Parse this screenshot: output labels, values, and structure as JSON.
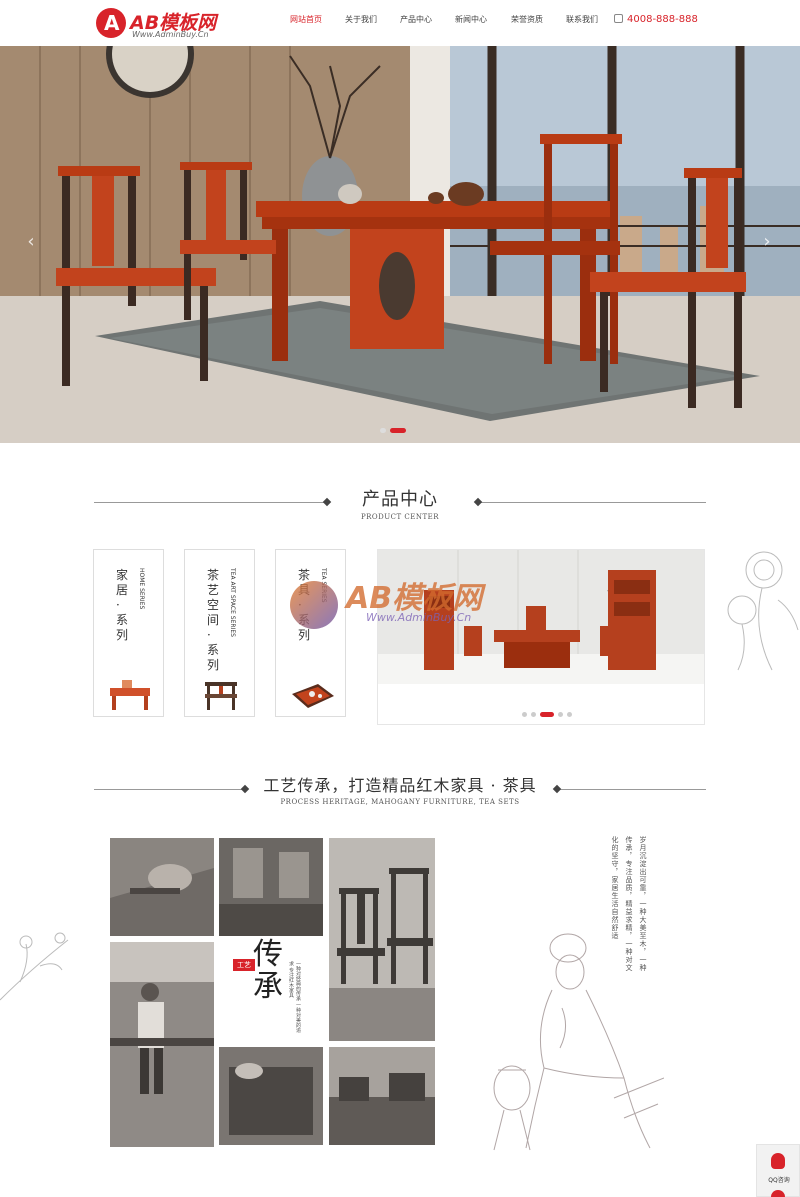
{
  "header": {
    "logo_text": "AB模板网",
    "logo_url": "Www.AdminBuy.Cn",
    "nav": [
      "网站首页",
      "关于我们",
      "产品中心",
      "新闻中心",
      "荣誉资质",
      "联系我们"
    ],
    "active_nav": "网站首页",
    "phone": "4008-888-888"
  },
  "hero": {
    "prev_icon": "chevron-left-icon",
    "next_icon": "chevron-right-icon",
    "slide_count": 2,
    "active_slide": 2
  },
  "products": {
    "title": "产品中心",
    "subtitle": "PRODUCT CENTER",
    "series": [
      {
        "cn": "家居·系列",
        "en": "HOME SERIES"
      },
      {
        "cn": "茶艺空间·系列",
        "en": "TEA ART SPACE SERIES"
      },
      {
        "cn": "茶具·系列",
        "en": "TEA SERIES"
      }
    ],
    "slider_count": 5,
    "slider_active": 3,
    "watermark_text": "AB模板网",
    "watermark_url": "Www.AdminBuy.Cn"
  },
  "craft": {
    "title": "工艺传承，打造精品红木家具 · 茶具",
    "subtitle": "PROCESS HERITAGE, MAHOGANY FURNITURE, TEA SETS",
    "stamp": "工艺",
    "big_text": "传承",
    "small_text": "一种对经典的传承 一种对美的追求 专注红木家具",
    "poem": "岁月沉淀出可靠，一种大美至木，一种传承，专注品质，精益求精，一种对文化的坚守，家居生活自然舒适"
  },
  "float": {
    "qq_label": "QQ咨询"
  },
  "colors": {
    "brand": "#d8232a",
    "mahogany": "#c2431d"
  }
}
